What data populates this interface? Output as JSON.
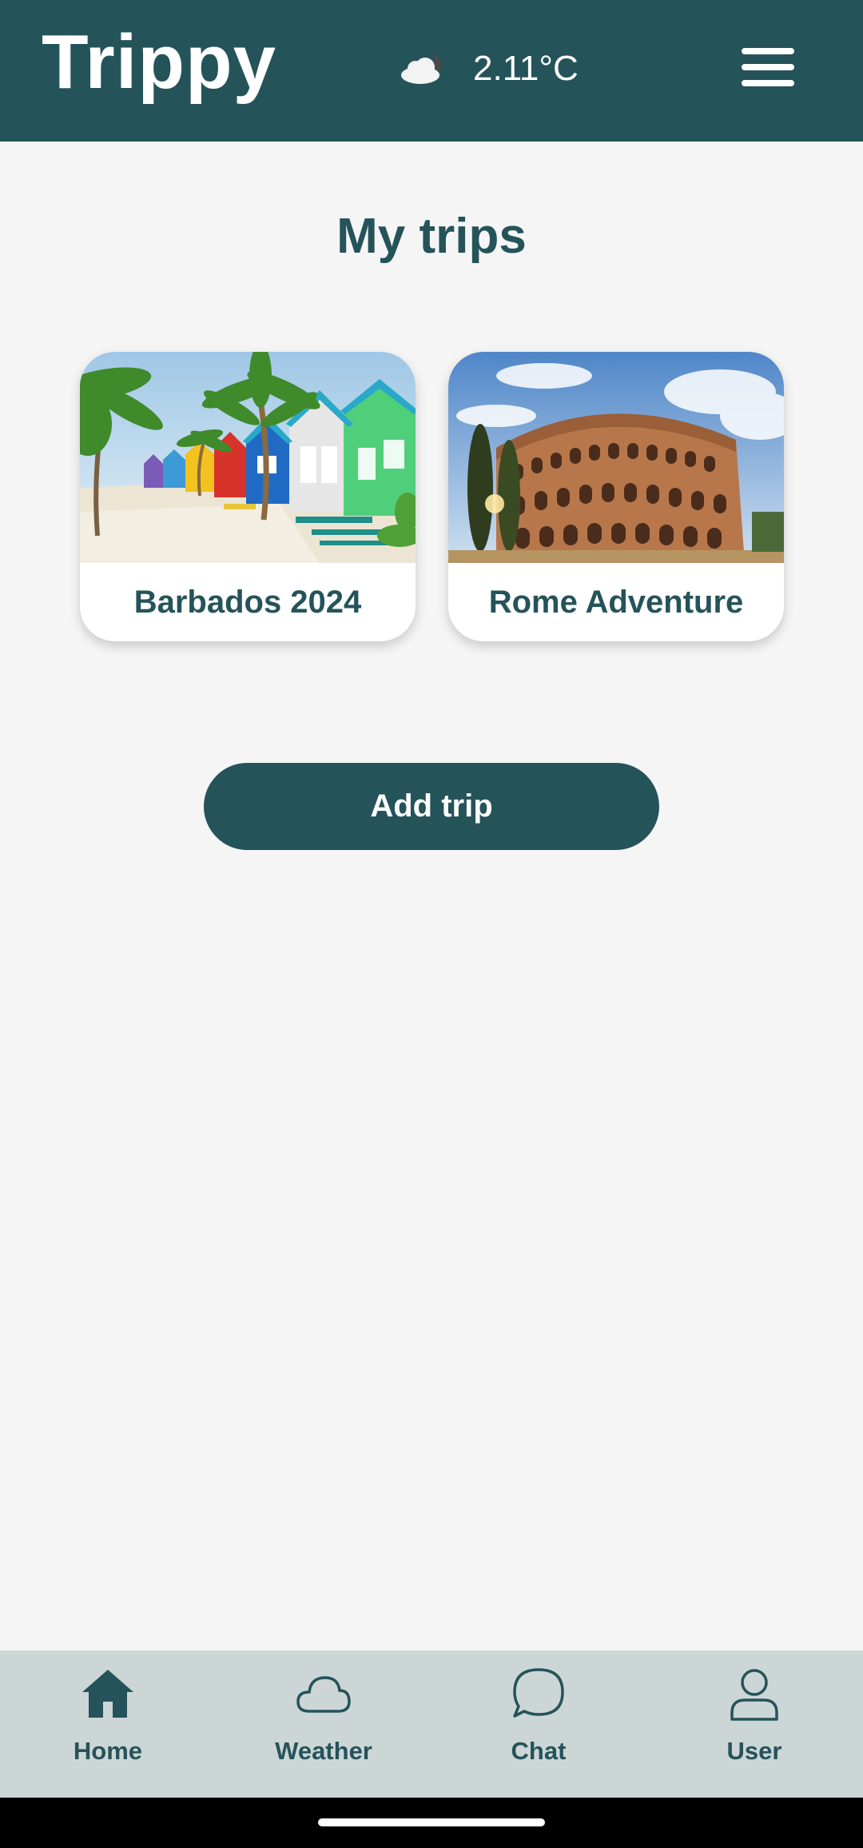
{
  "header": {
    "app_name": "Trippy",
    "weather_icon": "cloudy-night-icon",
    "temperature": "2.11°C",
    "menu_icon": "hamburger-menu-icon"
  },
  "main": {
    "title": "My trips",
    "trips": [
      {
        "name": "Barbados 2024",
        "image": "beach-huts-photo"
      },
      {
        "name": "Rome Adventure",
        "image": "colosseum-photo"
      }
    ],
    "add_button_label": "Add trip"
  },
  "bottom_nav": {
    "items": [
      {
        "label": "Home",
        "icon": "home-icon",
        "active": true
      },
      {
        "label": "Weather",
        "icon": "cloud-icon",
        "active": false
      },
      {
        "label": "Chat",
        "icon": "chat-bubble-icon",
        "active": false
      },
      {
        "label": "User",
        "icon": "user-icon",
        "active": false
      }
    ]
  },
  "colors": {
    "primary": "#25535a",
    "background": "#f5f5f5",
    "nav_background": "#cdd6d6",
    "card_background": "#ffffff"
  }
}
